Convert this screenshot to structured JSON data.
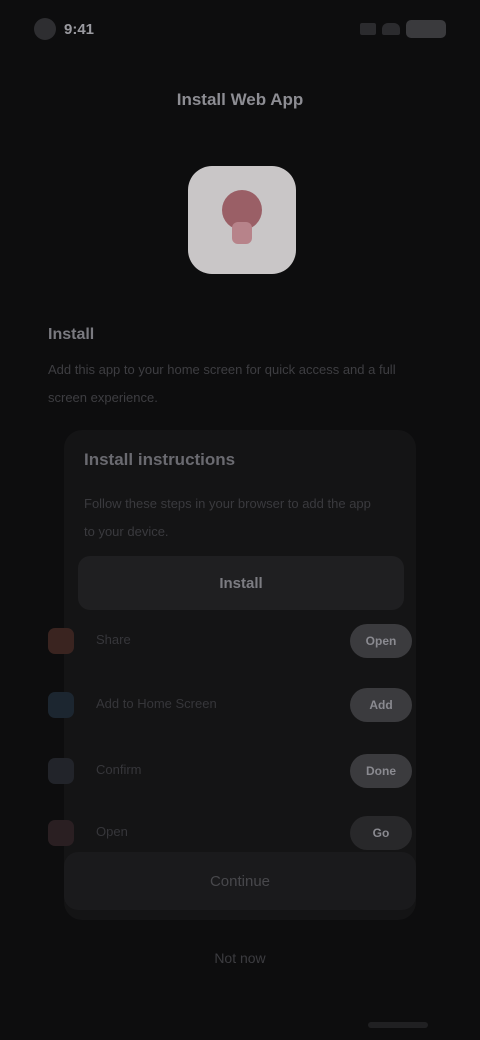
{
  "status": {
    "time": "9:41"
  },
  "page": {
    "title": "Install Web App"
  },
  "app": {
    "icon_name": "app-logo-icon"
  },
  "section": {
    "label": "Install",
    "description": "Add this app to your home screen for quick access and a full screen experience."
  },
  "card": {
    "title": "Install instructions",
    "description": "Follow these steps in your browser to add the app to your device.",
    "button_label": "Install"
  },
  "options": [
    {
      "label": "Share",
      "button": "Open",
      "icon_color": "#3a2420"
    },
    {
      "label": "Add to Home Screen",
      "button": "Add",
      "icon_color": "#1c2630"
    },
    {
      "label": "Confirm",
      "button": "Done",
      "icon_color": "#22242a"
    },
    {
      "label": "Open",
      "button": "Go",
      "icon_color": "#2a1f22"
    }
  ],
  "bottom": {
    "button_label": "Continue"
  },
  "footer": {
    "link_label": "Not now"
  }
}
